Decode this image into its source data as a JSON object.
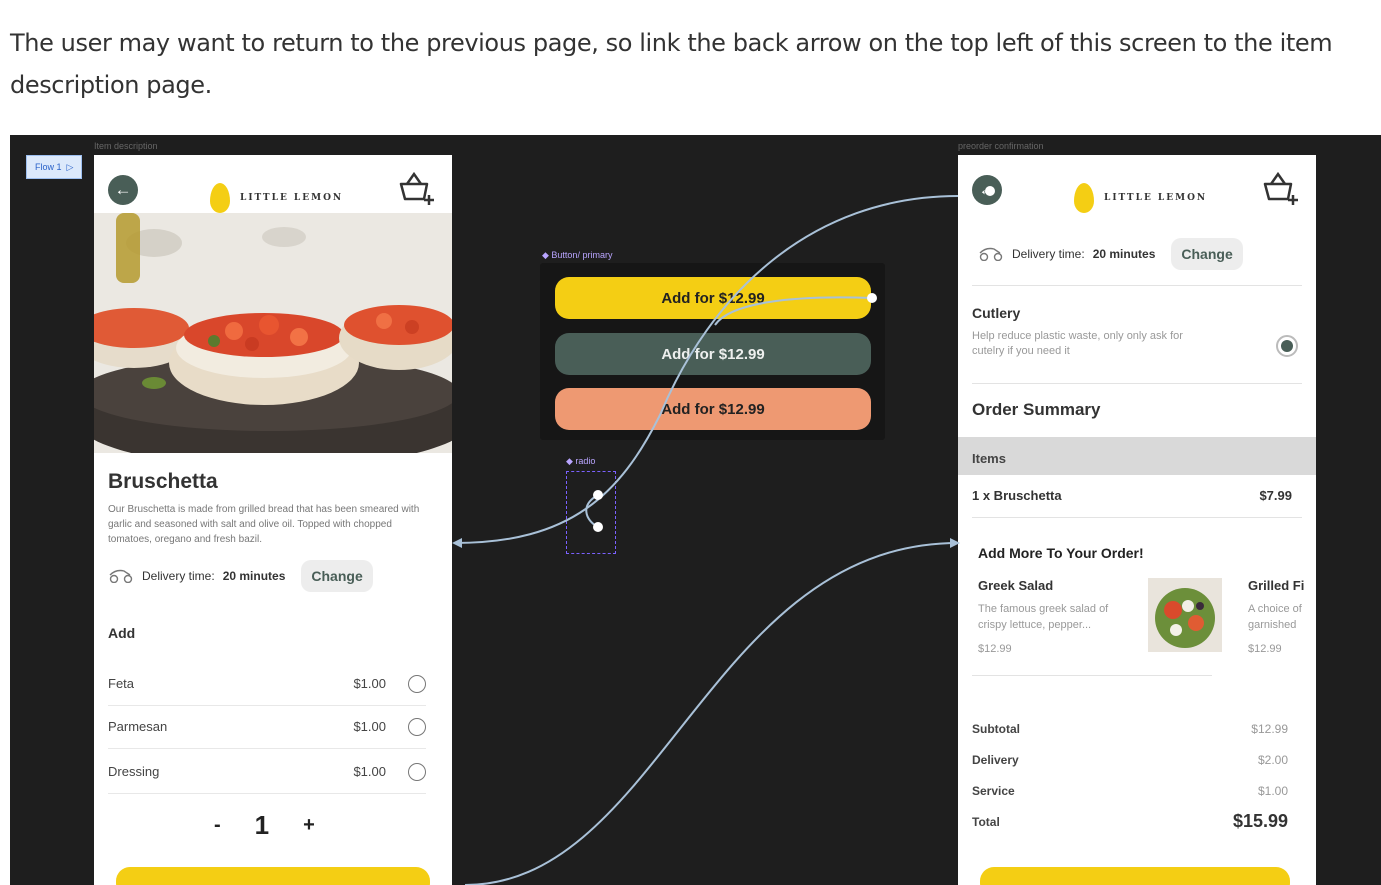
{
  "instruction": "The user may want to return to the previous page, so link the back arrow on the top left of this screen to the item description page.",
  "canvas": {
    "flow_label": "Flow 1",
    "left_frame_label": "Item description",
    "right_frame_label": "preorder confirmation"
  },
  "item_page": {
    "brand": "LITTLE LEMON",
    "dish_title": "Bruschetta",
    "dish_description": "Our Bruschetta is made from grilled bread that has been smeared with garlic and seasoned with salt and olive oil. Topped with chopped tomatoes, oregano and fresh bazil.",
    "delivery_label": "Delivery time:",
    "delivery_value": "20 minutes",
    "change_label": "Change",
    "add_heading": "Add",
    "options": [
      {
        "name": "Feta",
        "price": "$1.00"
      },
      {
        "name": "Parmesan",
        "price": "$1.00"
      },
      {
        "name": "Dressing",
        "price": "$1.00"
      }
    ],
    "qty_minus": "-",
    "qty_value": "1",
    "qty_plus": "+"
  },
  "components": {
    "buttons_label": "Button/ primary",
    "radio_label": "radio",
    "variants": [
      {
        "label": "Add for $12.99",
        "bg": "#F4CE14",
        "fg": "#222222"
      },
      {
        "label": "Add for $12.99",
        "bg": "#495E57",
        "fg": "#EDEFEE"
      },
      {
        "label": "Add for $12.99",
        "bg": "#EE9972",
        "fg": "#222222"
      }
    ]
  },
  "confirm_page": {
    "brand": "LITTLE LEMON",
    "delivery_label": "Delivery time:",
    "delivery_value": "20 minutes",
    "change_label": "Change",
    "cutlery_title": "Cutlery",
    "cutlery_desc": "Help reduce plastic waste, only only ask for cutelry if you need it",
    "cutlery_selected": true,
    "summary_title": "Order Summary",
    "items_header": "Items",
    "line_item": {
      "name": "1 x Bruschetta",
      "price": "$7.99"
    },
    "more_title": "Add More To Your Order!",
    "suggestions": [
      {
        "name": "Greek Salad",
        "desc": "The famous greek salad of crispy lettuce, pepper...",
        "price": "$12.99"
      },
      {
        "name": "Grilled Fi",
        "desc": "A choice of garnished",
        "price": "$12.99"
      }
    ],
    "totals": [
      {
        "label": "Subtotal",
        "value": "$12.99"
      },
      {
        "label": "Delivery",
        "value": "$2.00"
      },
      {
        "label": "Service",
        "value": "$1.00"
      },
      {
        "label": "Total",
        "value": "$15.99"
      }
    ]
  },
  "colors": {
    "canvas_bg": "#1E1E1E",
    "primary_green": "#495E57",
    "primary_yellow": "#F4CE14",
    "salmon": "#EE9972",
    "prototype_wire": "#A9C1D8"
  }
}
